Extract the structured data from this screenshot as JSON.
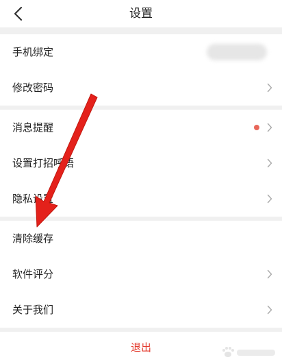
{
  "header": {
    "title": "设置"
  },
  "groups": [
    {
      "items": [
        {
          "label": "手机绑定"
        },
        {
          "label": "修改密码"
        }
      ]
    },
    {
      "items": [
        {
          "label": "消息提醒"
        },
        {
          "label": "设置打招呼语"
        },
        {
          "label": "隐私设置"
        }
      ]
    },
    {
      "items": [
        {
          "label": "清除缓存"
        },
        {
          "label": "软件评分"
        },
        {
          "label": "关于我们"
        }
      ]
    }
  ],
  "logout": {
    "label": "退出"
  },
  "colors": {
    "logout_text": "#e33b2e",
    "notification_dot": "#e8675a",
    "arrow": "#e4211b"
  }
}
